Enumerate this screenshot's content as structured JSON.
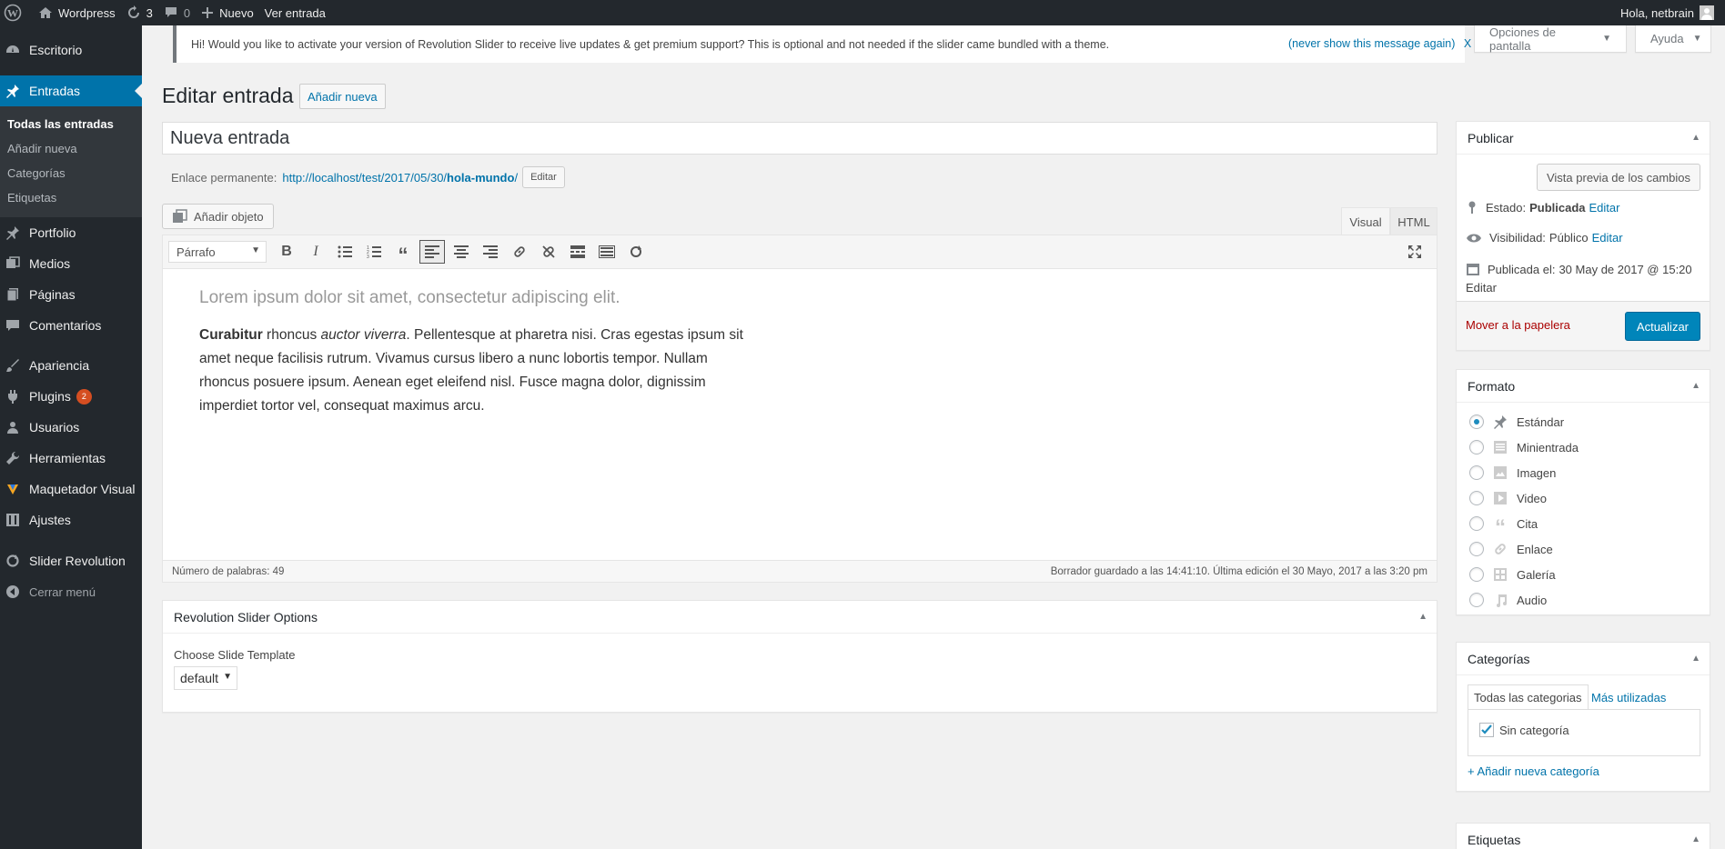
{
  "adminbar": {
    "site_name": "Wordpress",
    "updates_count": "3",
    "comments_count": "0",
    "new_label": "Nuevo",
    "view_post": "Ver entrada",
    "greeting": "Hola, netbrain"
  },
  "sidebar": {
    "items": [
      {
        "label": "Escritorio",
        "icon": "dashboard-icon"
      },
      {
        "label": "Entradas",
        "icon": "pin-icon"
      },
      {
        "label": "Portfolio",
        "icon": "pin-icon"
      },
      {
        "label": "Medios",
        "icon": "media-icon"
      },
      {
        "label": "Páginas",
        "icon": "pages-icon"
      },
      {
        "label": "Comentarios",
        "icon": "comments-icon"
      },
      {
        "label": "Apariencia",
        "icon": "appearance-icon"
      },
      {
        "label": "Plugins",
        "icon": "plugins-icon",
        "badge": "2"
      },
      {
        "label": "Usuarios",
        "icon": "users-icon"
      },
      {
        "label": "Herramientas",
        "icon": "tools-icon"
      },
      {
        "label": "Maquetador Visual",
        "icon": "builder-icon"
      },
      {
        "label": "Ajustes",
        "icon": "settings-icon"
      },
      {
        "label": "Slider Revolution",
        "icon": "refresh-icon"
      },
      {
        "label": "Cerrar menú",
        "icon": "collapse-icon"
      }
    ],
    "submenu": [
      "Todas las entradas",
      "Añadir nueva",
      "Categorías",
      "Etiquetas"
    ]
  },
  "screen_options": "Opciones de pantalla",
  "help": "Ayuda",
  "notice": {
    "text": "Hi! Would you like to activate your version of Revolution Slider to receive live updates & get premium support? This is optional and not needed if the slider came bundled with a theme.",
    "dismiss": "(never show this message again)",
    "close": "X"
  },
  "page": {
    "heading": "Editar entrada",
    "add_new": "Añadir nueva",
    "title_value": "Nueva entrada",
    "permalink_label": "Enlace permanente:",
    "permalink_base": "http://localhost/test/2017/05/30/",
    "permalink_slug": "hola-mundo",
    "permalink_end": "/",
    "permalink_edit": "Editar",
    "add_media": "Añadir objeto",
    "tab_visual": "Visual",
    "tab_html": "HTML"
  },
  "editor": {
    "format": "Párrafo",
    "heading": "Lorem ipsum dolor sit amet, consectetur adipiscing elit.",
    "p1_bold": "Curabitur",
    "p1_a": " rhoncus ",
    "p1_italic": "auctor viverra",
    "p1_b": ". Pellentesque at pharetra nisi. Cras egestas ipsum sit amet neque facilisis rutrum. Vivamus cursus libero a nunc lobortis tempor. Nullam rhoncus posuere ipsum. Aenean eget eleifend nisl. Fusce magna dolor, dignissim imperdiet tortor vel, consequat maximus arcu.",
    "word_count": "Número de palabras: 49",
    "autosave": "Borrador guardado a las 14:41:10. Última edición el 30 Mayo, 2017 a las 3:20 pm"
  },
  "rev_slider": {
    "title": "Revolution Slider Options",
    "label": "Choose Slide Template",
    "value": "default"
  },
  "publish": {
    "title": "Publicar",
    "preview": "Vista previa de los cambios",
    "status_label": "Estado:",
    "status_value": "Publicada",
    "visibility_label": "Visibilidad:",
    "visibility_value": "Público",
    "published_label": "Publicada el:",
    "published_value": "30 May de 2017 @ 15:20",
    "edit": "Editar",
    "trash": "Mover a la papelera",
    "update": "Actualizar"
  },
  "format_box": {
    "title": "Formato",
    "options": [
      "Estándar",
      "Minientrada",
      "Imagen",
      "Video",
      "Cita",
      "Enlace",
      "Galería",
      "Audio"
    ],
    "selected": "Estándar"
  },
  "categories": {
    "title": "Categorías",
    "tab_all": "Todas las categorias",
    "tab_used": "Más utilizadas",
    "items": [
      {
        "label": "Sin categoría",
        "checked": true
      }
    ],
    "add_new": "+ Añadir nueva categoría"
  },
  "tags": {
    "title": "Etiquetas"
  },
  "colors": {
    "accent": "#0073aa",
    "sidebar": "#23282d",
    "primary_button": "#0085ba",
    "badge": "#d54e21"
  }
}
